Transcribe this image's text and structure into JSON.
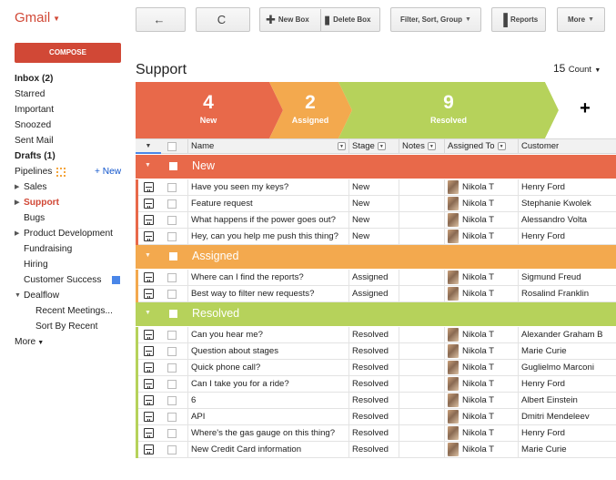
{
  "app": {
    "logo": "Gmail",
    "compose_label": "COMPOSE"
  },
  "sidebar": {
    "inbox": "Inbox (2)",
    "starred": "Starred",
    "important": "Important",
    "snoozed": "Snoozed",
    "sent": "Sent Mail",
    "drafts": "Drafts (1)",
    "pipelines": "Pipelines",
    "new_link": "+ New",
    "sales": "Sales",
    "support": "Support",
    "bugs": "Bugs",
    "product_dev": "Product Development",
    "fundraising": "Fundraising",
    "hiring": "Hiring",
    "customer_success": "Customer Success",
    "dealflow": "Dealflow",
    "recent_meetings": "Recent Meetings...",
    "sort_by_recent": "Sort By Recent",
    "more": "More"
  },
  "toolbar": {
    "back_icon": "←",
    "refresh_icon": "C",
    "new_box": "New Box",
    "delete_box": "Delete Box",
    "filter": "Filter, Sort, Group",
    "reports": "Reports",
    "more": "More"
  },
  "box": {
    "title": "Support",
    "count_value": "15",
    "count_label": "Count"
  },
  "stages": [
    {
      "count": "4",
      "name": "New",
      "color": "#e8694a"
    },
    {
      "count": "2",
      "name": "Assigned",
      "color": "#f3a94e"
    },
    {
      "count": "9",
      "name": "Resolved",
      "color": "#b6d25b"
    },
    {
      "count": "+",
      "name": "",
      "color": "#ffffff"
    }
  ],
  "columns": {
    "name": "Name",
    "stage": "Stage",
    "notes": "Notes",
    "assigned_to": "Assigned To",
    "customer": "Customer"
  },
  "groups": [
    {
      "name": "New",
      "color": "#e8694a",
      "rows": [
        {
          "name": "Have you seen my keys?",
          "stage": "New",
          "assigned": "Nikola T",
          "customer": "Henry Ford"
        },
        {
          "name": "Feature request",
          "stage": "New",
          "assigned": "Nikola T",
          "customer": "Stephanie Kwolek"
        },
        {
          "name": "What happens if the power goes out?",
          "stage": "New",
          "assigned": "Nikola T",
          "customer": "Alessandro Volta"
        },
        {
          "name": "Hey, can you help me push this thing?",
          "stage": "New",
          "assigned": "Nikola T",
          "customer": "Henry Ford"
        }
      ]
    },
    {
      "name": "Assigned",
      "color": "#f3a94e",
      "rows": [
        {
          "name": "Where can I find the reports?",
          "stage": "Assigned",
          "assigned": "Nikola T",
          "customer": "Sigmund Freud"
        },
        {
          "name": "Best way to filter new requests?",
          "stage": "Assigned",
          "assigned": "Nikola T",
          "customer": "Rosalind Franklin"
        }
      ]
    },
    {
      "name": "Resolved",
      "color": "#b6d25b",
      "rows": [
        {
          "name": "Can you hear me?",
          "stage": "Resolved",
          "assigned": "Nikola T",
          "customer": "Alexander Graham B"
        },
        {
          "name": "Question about stages",
          "stage": "Resolved",
          "assigned": "Nikola T",
          "customer": "Marie Curie"
        },
        {
          "name": "Quick phone call?",
          "stage": "Resolved",
          "assigned": "Nikola T",
          "customer": "Guglielmo Marconi"
        },
        {
          "name": "Can I take you for a ride?",
          "stage": "Resolved",
          "assigned": "Nikola T",
          "customer": "Henry Ford"
        },
        {
          "name": "6",
          "stage": "Resolved",
          "assigned": "Nikola T",
          "customer": "Albert Einstein"
        },
        {
          "name": "API",
          "stage": "Resolved",
          "assigned": "Nikola T",
          "customer": "Dmitri Mendeleev"
        },
        {
          "name": "Where's the gas gauge on this thing?",
          "stage": "Resolved",
          "assigned": "Nikola T",
          "customer": "Henry Ford"
        },
        {
          "name": "New Credit Card information",
          "stage": "Resolved",
          "assigned": "Nikola T",
          "customer": "Marie Curie"
        }
      ]
    }
  ]
}
